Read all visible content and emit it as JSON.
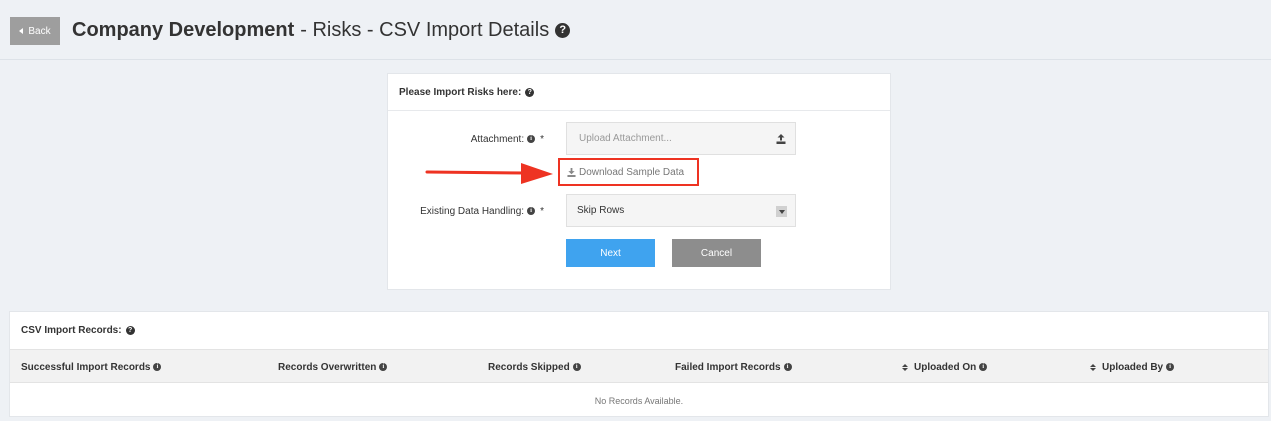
{
  "header": {
    "back_label": "Back",
    "title_bold": "Company Development",
    "title_rest": "- Risks - CSV Import Details"
  },
  "import_card": {
    "title": "Please Import Risks here:",
    "attachment_label": "Attachment:",
    "required_mark": "*",
    "upload_placeholder": "Upload Attachment...",
    "download_link": "Download Sample Data",
    "handling_label": "Existing Data Handling:",
    "handling_value": "Skip Rows",
    "next_label": "Next",
    "cancel_label": "Cancel"
  },
  "records": {
    "title": "CSV Import Records:",
    "columns": [
      "Successful Import Records",
      "Records Overwritten",
      "Records Skipped",
      "Failed Import Records",
      "Uploaded On",
      "Uploaded By"
    ],
    "empty_message": "No Records Available."
  },
  "colors": {
    "accent_blue": "#3fa3ef",
    "highlight_red": "#ee3322",
    "cancel_gray": "#8d8d8d"
  },
  "icons": {
    "help": "question-circle-icon",
    "info": "info-circle-icon",
    "upload": "upload-icon",
    "download": "download-icon",
    "sort": "sort-icon"
  }
}
